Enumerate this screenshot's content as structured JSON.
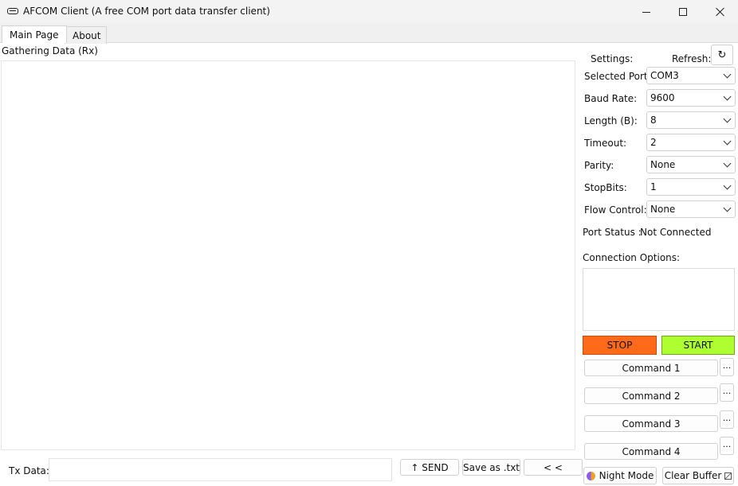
{
  "window": {
    "title": "AFCOM Client (A free COM port data transfer client)"
  },
  "tabs": [
    {
      "label": "Main Page"
    },
    {
      "label": "About"
    }
  ],
  "rx": {
    "label": "Gathering Data (Rx)",
    "content": ""
  },
  "tx": {
    "label": "Tx Data:",
    "value": "",
    "send_label": "↑ SEND",
    "save_label": "Save as .txt",
    "collapse_label": "< <"
  },
  "settings": {
    "title": "Settings:",
    "refresh_label": "Refresh:",
    "refresh_icon": "↻",
    "fields": [
      {
        "label": "Selected Port:",
        "value": "COM3"
      },
      {
        "label": "Baud Rate:",
        "value": "9600"
      },
      {
        "label": "Length (B):",
        "value": "8"
      },
      {
        "label": "Timeout:",
        "value": "2"
      },
      {
        "label": "Parity:",
        "value": "None"
      },
      {
        "label": "StopBits:",
        "value": "1"
      },
      {
        "label": "Flow Control:",
        "value": "None"
      }
    ],
    "port_status_label": "Port Status :",
    "port_status_value": "Not Connected",
    "connection_options_label": "Connection Options:",
    "connection_options_value": ""
  },
  "controls": {
    "stop_label": "STOP",
    "start_label": "START",
    "stop_color": "#ff6a1a",
    "start_color": "#adff2f",
    "commands": [
      {
        "label": "Command 1",
        "more": "..."
      },
      {
        "label": "Command 2",
        "more": "..."
      },
      {
        "label": "Command 3",
        "more": "..."
      },
      {
        "label": "Command 4",
        "more": "..."
      }
    ],
    "night_mode_label": "Night Mode",
    "clear_buffer_label": "Clear Buffer"
  }
}
